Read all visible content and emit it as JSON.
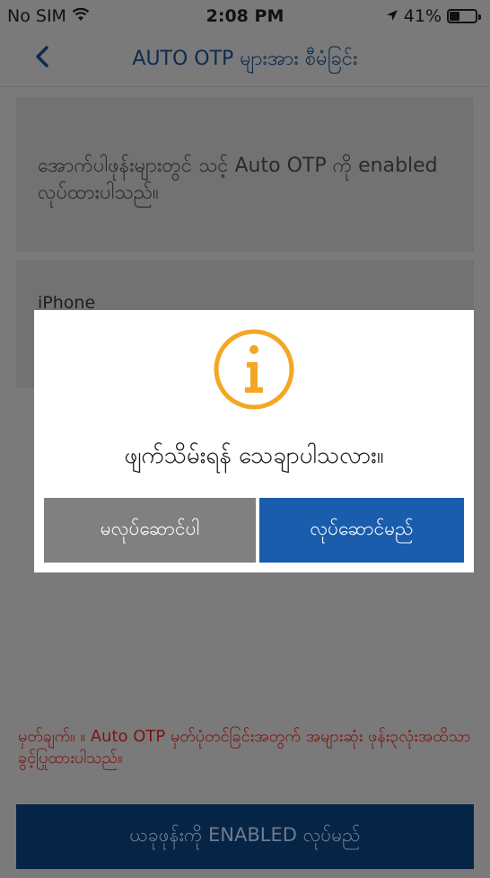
{
  "status_bar": {
    "carrier": "No SIM",
    "time": "2:08 PM",
    "battery_percent": "41%",
    "battery_level": 0.41,
    "icons": [
      "wifi-icon",
      "location-arrow-icon",
      "battery-icon"
    ]
  },
  "nav": {
    "back_icon": "chevron-left-icon",
    "title": "AUTO OTP များအား စီမံခြင်း"
  },
  "info_card": {
    "text": "အောက်ပါဖုန်းများတွင် သင့် Auto OTP ကို enabled လုပ်ထားပါသည်။"
  },
  "device_card": {
    "device_name": "iPhone"
  },
  "note": {
    "text": "မှတ်ချက်။ ။ Auto OTP မှတ်ပုံတင်ခြင်းအတွက် အများဆုံး ဖုန်း၃လုံးအထိသာ ခွင့်ပြုထားပါသည်။"
  },
  "enable_button": {
    "label": "ယခုဖုန်းကို ENABLED လုပ်မည်"
  },
  "modal": {
    "icon": "info-icon",
    "message": "ဖျက်သိမ်းရန် သေချာပါသလား။",
    "cancel_label": "မလုပ်ဆောင်ပါ",
    "confirm_label": "လုပ်ဆောင်မည်"
  },
  "colors": {
    "accent_blue": "#1a5dac",
    "info_orange": "#f5a623",
    "note_red": "#7a1410",
    "cancel_gray": "#808080",
    "dim_background": "#7a7a7a"
  }
}
